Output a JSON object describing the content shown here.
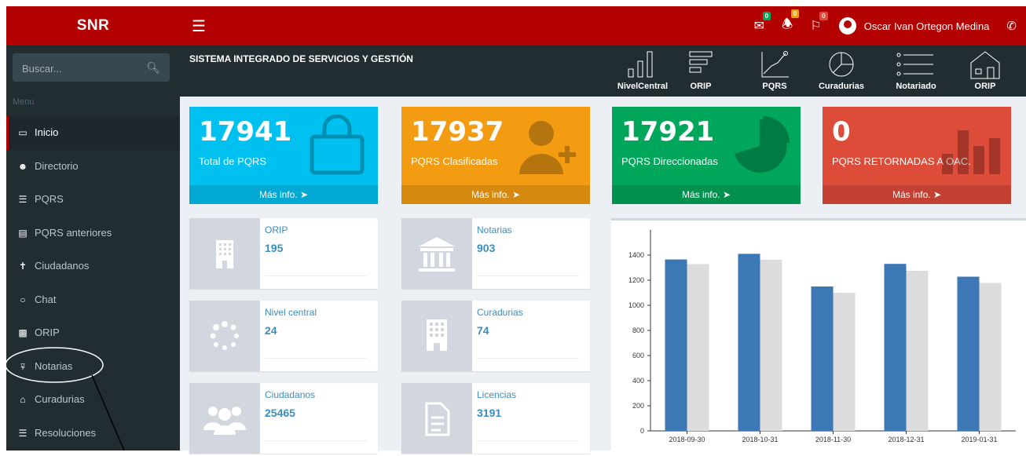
{
  "brand": "SNR",
  "header": {
    "badges": {
      "messages": "0",
      "notifications": "0",
      "flags": "0"
    },
    "user_name": "Oscar Ivan Ortegon Medina"
  },
  "sidebar": {
    "search_placeholder": "Buscar...",
    "menu_label": "Menu",
    "items": [
      {
        "label": "Inicio",
        "icon": "laptop-icon"
      },
      {
        "label": "Directorio",
        "icon": "users-icon"
      },
      {
        "label": "PQRS",
        "icon": "list-icon"
      },
      {
        "label": "PQRS anteriores",
        "icon": "card-icon"
      },
      {
        "label": "Ciudadanos",
        "icon": "person-icon"
      },
      {
        "label": "Chat",
        "icon": "chat-icon"
      },
      {
        "label": "ORIP",
        "icon": "building-icon"
      },
      {
        "label": "Notarias",
        "icon": "bank-icon"
      },
      {
        "label": "Curadurias",
        "icon": "home-icon"
      },
      {
        "label": "Resoluciones",
        "icon": "list-icon"
      }
    ]
  },
  "subheader": {
    "title": "SISTEMA INTEGRADO DE SERVICIOS Y GESTIÓN",
    "shortcuts": [
      "NivelCentral",
      "ORIP",
      "PQRS",
      "Curadurias",
      "Notariado",
      "ORIP"
    ]
  },
  "stat_boxes": [
    {
      "value": "17941",
      "label": "Total de PQRS",
      "more": "Más info.",
      "color": "#00c0ef"
    },
    {
      "value": "17937",
      "label": "PQRS Clasificadas",
      "more": "Más info.",
      "color": "#f39c12"
    },
    {
      "value": "17921",
      "label": "PQRS Direccionadas",
      "more": "Más info.",
      "color": "#00a65a"
    },
    {
      "value": "0",
      "label": "PQRS RETORNADAS A OAC.",
      "more": "Más info.",
      "color": "#dd4b39"
    }
  ],
  "info_boxes": [
    {
      "title": "ORIP",
      "value": "195"
    },
    {
      "title": "Notarias",
      "value": "903"
    },
    {
      "title": "Nivel central",
      "value": "24"
    },
    {
      "title": "Curadurias",
      "value": "74"
    },
    {
      "title": "Ciudadanos",
      "value": "25465"
    },
    {
      "title": "Licencias",
      "value": "3191"
    }
  ],
  "chart_data": {
    "type": "bar",
    "categories": [
      "2018-09-30",
      "2018-10-31",
      "2018-11-30",
      "2018-12-31",
      "2019-01-31"
    ],
    "series": [
      {
        "values": [
          1365,
          1410,
          1150,
          1330,
          1228
        ],
        "color": "#3c78b5"
      },
      {
        "values": [
          1328,
          1362,
          1100,
          1275,
          1178
        ],
        "color": "#dcdcdc"
      }
    ],
    "yticks": [
      0,
      200,
      400,
      600,
      800,
      1000,
      1200,
      1400
    ],
    "ylim": [
      0,
      1600
    ],
    "grid": false
  }
}
